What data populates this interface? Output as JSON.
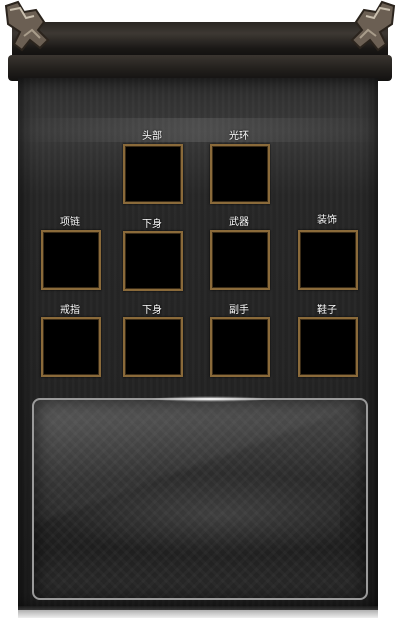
{
  "equipment": {
    "row1": [
      {
        "label": "头部"
      },
      {
        "label": "光环"
      }
    ],
    "row2": [
      {
        "label": "项链"
      },
      {
        "label": "下身"
      },
      {
        "label": "武器"
      },
      {
        "label": "装饰"
      }
    ],
    "row3": [
      {
        "label": "戒指"
      },
      {
        "label": "下身"
      },
      {
        "label": "副手"
      },
      {
        "label": "鞋子"
      }
    ]
  },
  "colors": {
    "slot_border": "#8a6a3a",
    "panel": "#2a2a2a",
    "label_text": "#ffffff"
  }
}
